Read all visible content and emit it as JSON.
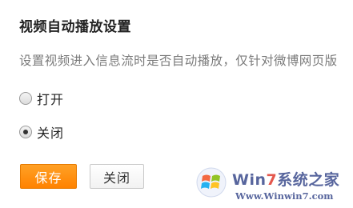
{
  "settings": {
    "title": "视频自动播放设置",
    "description": "设置视频进入信息流时是否自动播放，仅针对微博网页版",
    "options": [
      {
        "label": "打开",
        "selected": false
      },
      {
        "label": "关闭",
        "selected": true
      }
    ],
    "save_label": "保存",
    "close_label": "关闭"
  },
  "watermark": {
    "brand_prefix": "Win",
    "brand_seven": "7",
    "brand_suffix": "系统之家",
    "url": "Www.Winwin7.com"
  },
  "colors": {
    "accent": "#ff8a00",
    "title": "#222222",
    "description": "#7a7a7a"
  }
}
